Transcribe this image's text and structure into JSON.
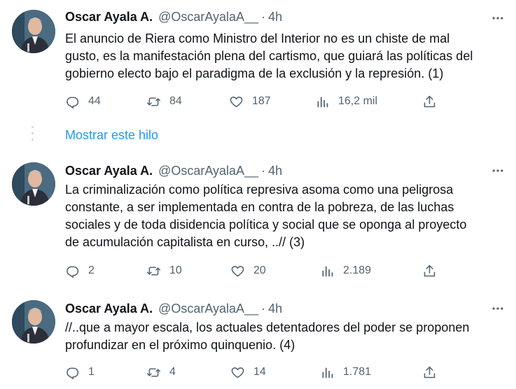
{
  "tweets": [
    {
      "name": "Oscar Ayala A.",
      "handle": "@OscarAyalaA__",
      "separator": "·",
      "time": "4h",
      "lines": [
        "El anuncio de Riera como Ministro del Interior no es un chiste de mal",
        "gusto, es la manifestación plena del cartismo, que guiará las políticas del",
        "gobierno electo bajo el paradigma de la exclusión y la represión. (1)"
      ],
      "replies": "44",
      "retweets": "84",
      "likes": "187",
      "views": "16,2 mil"
    },
    {
      "name": "Oscar Ayala A.",
      "handle": "@OscarAyalaA__",
      "separator": "·",
      "time": "4h",
      "lines": [
        "La criminalización como política represiva asoma como una peligrosa",
        "constante, a ser implementada en contra de  la pobreza, de las luchas",
        "sociales y de toda disidencia política y social que se oponga al proyecto",
        "de acumulación capitalista en curso, ..// (3)"
      ],
      "replies": "2",
      "retweets": "10",
      "likes": "20",
      "views": "2.189"
    },
    {
      "name": "Oscar Ayala A.",
      "handle": "@OscarAyalaA__",
      "separator": "·",
      "time": "4h",
      "lines": [
        "//..que a mayor escala, los actuales detentadores del poder se proponen",
        "profundizar en el próximo quinquenio. (4)"
      ],
      "replies": "1",
      "retweets": "4",
      "likes": "14",
      "views": "1.781"
    }
  ],
  "show_thread_label": "Mostrar este hilo",
  "icons": {
    "reply": "reply-icon",
    "retweet": "retweet-icon",
    "like": "heart-icon",
    "views": "views-icon",
    "share": "share-icon",
    "more": "more-icon"
  },
  "colors": {
    "text": "#0f1419",
    "secondary": "#536471",
    "link": "#1d9bf0"
  }
}
